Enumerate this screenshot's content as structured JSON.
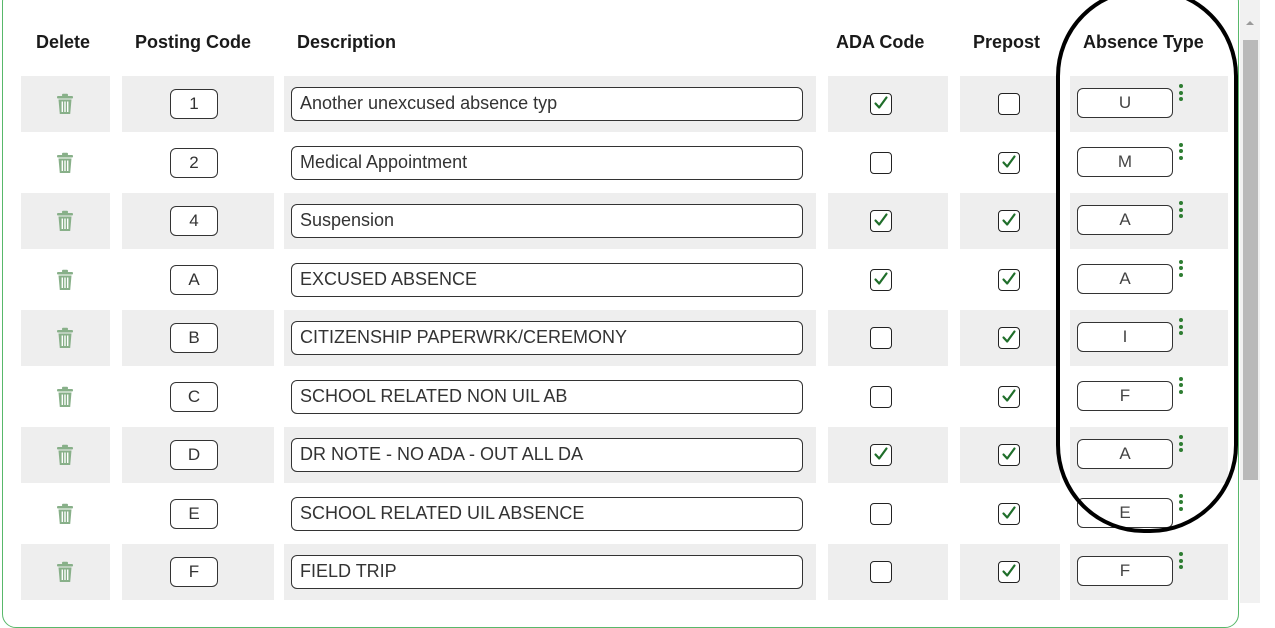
{
  "headers": {
    "delete": "Delete",
    "posting_code": "Posting Code",
    "description": "Description",
    "ada_code": "ADA Code",
    "prepost": "Prepost",
    "absence_type": "Absence Type"
  },
  "colors": {
    "accent_green": "#2e7d32",
    "border_green": "#58b86a",
    "row_shade": "#eeeeee"
  },
  "rows": [
    {
      "code": "1",
      "description": "Another unexcused absence typ",
      "ada": true,
      "prepost": false,
      "absence_type": "U"
    },
    {
      "code": "2",
      "description": "Medical Appointment",
      "ada": false,
      "prepost": true,
      "absence_type": "M"
    },
    {
      "code": "4",
      "description": "Suspension",
      "ada": true,
      "prepost": true,
      "absence_type": "A"
    },
    {
      "code": "A",
      "description": "EXCUSED ABSENCE",
      "ada": true,
      "prepost": true,
      "absence_type": "A"
    },
    {
      "code": "B",
      "description": "CITIZENSHIP PAPERWRK/CEREMONY",
      "ada": false,
      "prepost": true,
      "absence_type": "I"
    },
    {
      "code": "C",
      "description": "SCHOOL RELATED NON UIL AB",
      "ada": false,
      "prepost": true,
      "absence_type": "F"
    },
    {
      "code": "D",
      "description": "DR NOTE - NO ADA - OUT ALL DA",
      "ada": true,
      "prepost": true,
      "absence_type": "A"
    },
    {
      "code": "E",
      "description": "SCHOOL RELATED UIL ABSENCE",
      "ada": false,
      "prepost": true,
      "absence_type": "E"
    },
    {
      "code": "F",
      "description": "FIELD TRIP",
      "ada": false,
      "prepost": true,
      "absence_type": "F"
    }
  ]
}
